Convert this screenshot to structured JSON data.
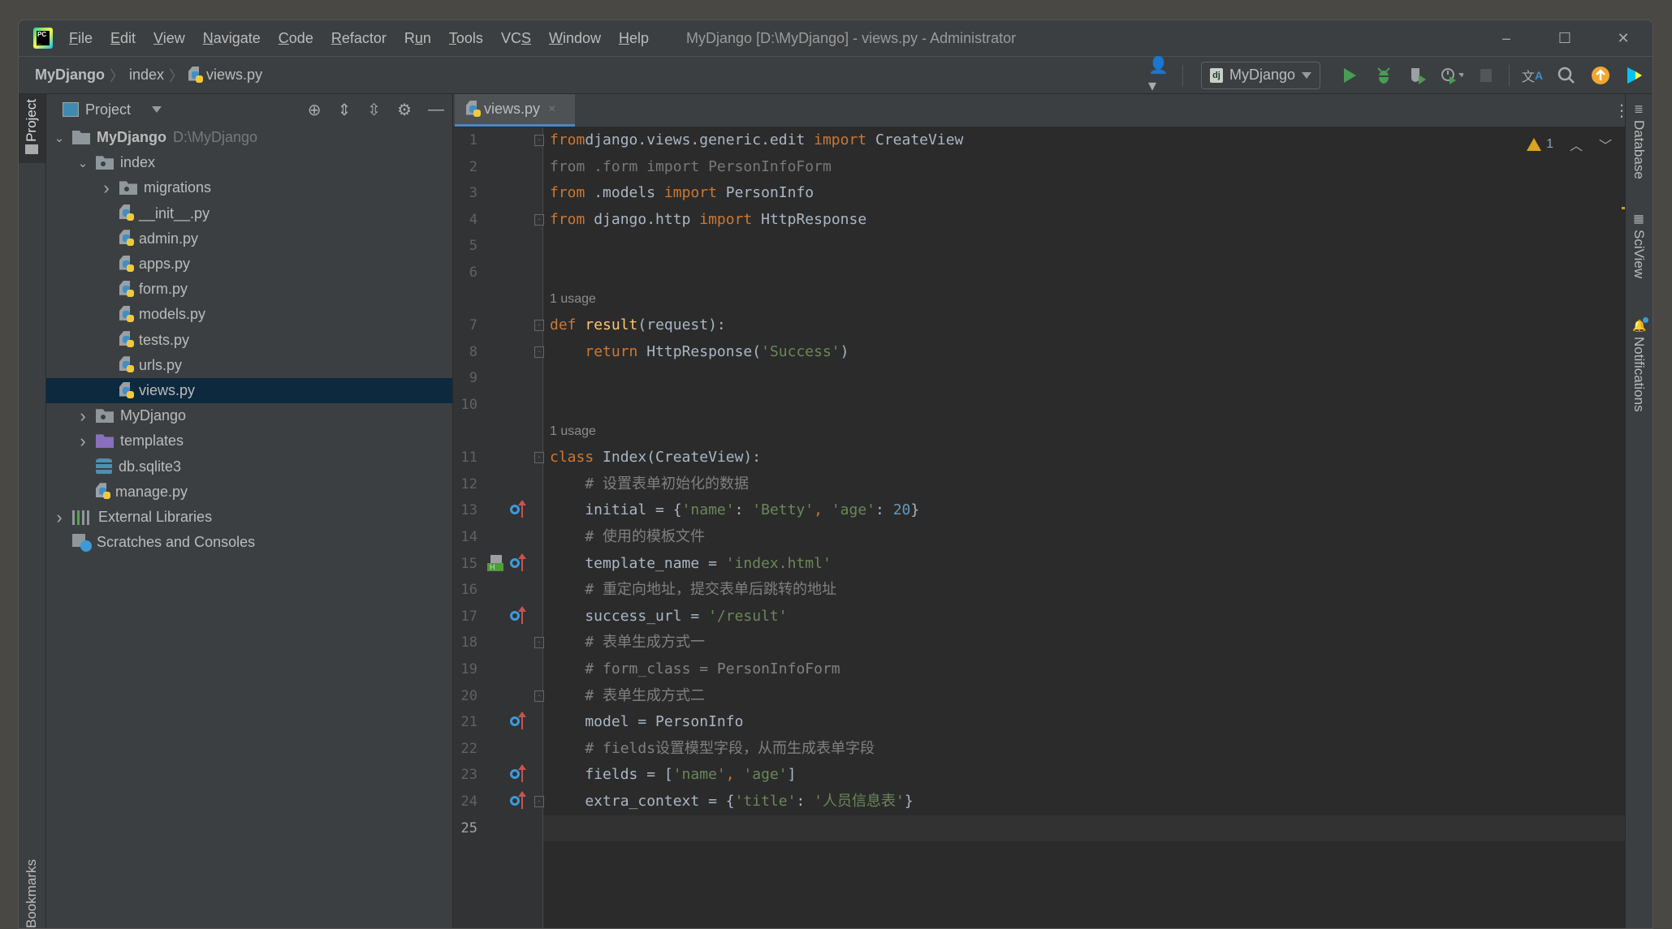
{
  "titlebar": {
    "menu": [
      {
        "label": "File",
        "mn": "F",
        "rest": "ile"
      },
      {
        "label": "Edit",
        "mn": "E",
        "rest": "dit"
      },
      {
        "label": "View",
        "mn": "V",
        "rest": "iew"
      },
      {
        "label": "Navigate",
        "mn": "N",
        "rest": "avigate"
      },
      {
        "label": "Code",
        "mn": "C",
        "rest": "ode"
      },
      {
        "label": "Refactor",
        "mn": "R",
        "rest": "efactor"
      },
      {
        "label": "Run",
        "pre": "R",
        "mn": "u",
        "rest": "n"
      },
      {
        "label": "Tools",
        "mn": "T",
        "rest": "ools"
      },
      {
        "label": "VCS",
        "pre": "VC",
        "mn": "S",
        "rest": ""
      },
      {
        "label": "Window",
        "mn": "W",
        "rest": "indow"
      },
      {
        "label": "Help",
        "mn": "H",
        "rest": "elp"
      }
    ],
    "window_title": "MyDjango [D:\\MyDjango] - views.py - Administrator",
    "controls": {
      "minimize": "–",
      "maximize": "☐",
      "close": "✕"
    }
  },
  "navbar": {
    "breadcrumb": [
      "MyDjango",
      "index",
      "views.py"
    ],
    "run_config": {
      "badge": "dj",
      "label": "MyDjango"
    },
    "icons": [
      "account-icon",
      "run-icon",
      "debug-icon",
      "coverage-icon",
      "profile-icon",
      "stop-icon",
      "translate-icon",
      "search-icon",
      "update-icon",
      "toolbox-icon"
    ],
    "colors": {
      "run": "#499c54",
      "update": "#f0a732"
    }
  },
  "left_strip": {
    "project_tab": "Project",
    "bookmarks_tab": "Bookmarks"
  },
  "project_panel": {
    "title": "Project",
    "tree": [
      {
        "depth": 0,
        "chevron": "open",
        "icon": "folder",
        "label": "MyDjango",
        "hint": "D:\\MyDjango",
        "bold": true
      },
      {
        "depth": 1,
        "chevron": "open",
        "icon": "module",
        "label": "index"
      },
      {
        "depth": 2,
        "chevron": "closed",
        "icon": "module",
        "label": "migrations"
      },
      {
        "depth": 2,
        "chevron": "none",
        "icon": "python",
        "label": "__init__.py"
      },
      {
        "depth": 2,
        "chevron": "none",
        "icon": "python",
        "label": "admin.py"
      },
      {
        "depth": 2,
        "chevron": "none",
        "icon": "python",
        "label": "apps.py"
      },
      {
        "depth": 2,
        "chevron": "none",
        "icon": "python",
        "label": "form.py"
      },
      {
        "depth": 2,
        "chevron": "none",
        "icon": "python",
        "label": "models.py"
      },
      {
        "depth": 2,
        "chevron": "none",
        "icon": "python",
        "label": "tests.py"
      },
      {
        "depth": 2,
        "chevron": "none",
        "icon": "python",
        "label": "urls.py"
      },
      {
        "depth": 2,
        "chevron": "none",
        "icon": "python",
        "label": "views.py",
        "selected": true
      },
      {
        "depth": 1,
        "chevron": "closed",
        "icon": "module",
        "label": "MyDjango"
      },
      {
        "depth": 1,
        "chevron": "closed",
        "icon": "templates",
        "label": "templates"
      },
      {
        "depth": 1,
        "chevron": "none",
        "icon": "database",
        "label": "db.sqlite3"
      },
      {
        "depth": 1,
        "chevron": "none",
        "icon": "python",
        "label": "manage.py"
      },
      {
        "depth": 0,
        "chevron": "closed",
        "icon": "library",
        "label": "External Libraries"
      },
      {
        "depth": 0,
        "chevron": "none",
        "icon": "scratch",
        "label": "Scratches and Consoles"
      }
    ]
  },
  "editor": {
    "tab": {
      "label": "views.py",
      "close": "×"
    },
    "inspection": {
      "warnings": "1"
    },
    "current_line": 25,
    "lines": [
      {
        "n": "1",
        "fold": "start",
        "tokens": [
          [
            "kw",
            "from"
          ],
          [
            "",
            "django.views.generic.edit "
          ],
          [
            "kw",
            "import"
          ],
          [
            "",
            " CreateView"
          ]
        ]
      },
      {
        "n": "2",
        "tokens": [
          [
            "unused",
            "from .form import PersonInfoForm"
          ]
        ]
      },
      {
        "n": "3",
        "tokens": [
          [
            "kw",
            "from"
          ],
          [
            "",
            " .models "
          ],
          [
            "kw",
            "import"
          ],
          [
            "",
            " PersonInfo"
          ]
        ]
      },
      {
        "n": "4",
        "fold": "end",
        "tokens": [
          [
            "kw",
            "from"
          ],
          [
            "",
            " django.http "
          ],
          [
            "kw",
            "import"
          ],
          [
            "",
            " HttpResponse"
          ]
        ]
      },
      {
        "n": "5",
        "tokens": []
      },
      {
        "n": "6",
        "tokens": []
      },
      {
        "hint": "1 usage"
      },
      {
        "n": "7",
        "fold": "start",
        "tokens": [
          [
            "kw",
            "def "
          ],
          [
            "fn",
            "result"
          ],
          [
            "",
            "(request):"
          ]
        ]
      },
      {
        "n": "8",
        "fold": "end",
        "tokens": [
          [
            "",
            "    "
          ],
          [
            "kw",
            "return"
          ],
          [
            "",
            " HttpResponse("
          ],
          [
            "str",
            "'Success'"
          ],
          [
            "",
            ")"
          ]
        ]
      },
      {
        "n": "9",
        "tokens": []
      },
      {
        "n": "10",
        "tokens": []
      },
      {
        "hint": "1 usage"
      },
      {
        "n": "11",
        "fold": "start",
        "tokens": [
          [
            "kw",
            "class"
          ],
          [
            "",
            " Index(CreateView):"
          ]
        ]
      },
      {
        "n": "12",
        "tokens": [
          [
            "",
            "    "
          ],
          [
            "cm",
            "# 设置表单初始化的数据"
          ]
        ]
      },
      {
        "n": "13",
        "override": true,
        "tokens": [
          [
            "",
            "    initial = {"
          ],
          [
            "str",
            "'name'"
          ],
          [
            "",
            ": "
          ],
          [
            "str",
            "'Betty'"
          ],
          [
            "kw",
            ","
          ],
          [
            " ",
            ""
          ],
          [
            "str",
            " 'age'"
          ],
          [
            "",
            ": "
          ],
          [
            "num",
            "20"
          ],
          [
            "",
            "}"
          ]
        ]
      },
      {
        "n": "14",
        "tokens": [
          [
            "",
            "    "
          ],
          [
            "cm",
            "# 使用的模板文件"
          ]
        ]
      },
      {
        "n": "15",
        "override": true,
        "html": true,
        "tokens": [
          [
            "",
            "    template_name = "
          ],
          [
            "str",
            "'index.html'"
          ]
        ]
      },
      {
        "n": "16",
        "tokens": [
          [
            "",
            "    "
          ],
          [
            "cm",
            "# 重定向地址，提交表单后跳转的地址"
          ]
        ]
      },
      {
        "n": "17",
        "override": true,
        "tokens": [
          [
            "",
            "    success_url = "
          ],
          [
            "str",
            "'/result'"
          ]
        ]
      },
      {
        "n": "18",
        "fold": "start",
        "tokens": [
          [
            "",
            "    "
          ],
          [
            "cm",
            "# 表单生成方式一"
          ]
        ]
      },
      {
        "n": "19",
        "tokens": [
          [
            "",
            "    "
          ],
          [
            "cm",
            "# form_class = PersonInfoForm"
          ]
        ]
      },
      {
        "n": "20",
        "fold": "end",
        "tokens": [
          [
            "",
            "    "
          ],
          [
            "cm",
            "# 表单生成方式二"
          ]
        ]
      },
      {
        "n": "21",
        "override": true,
        "tokens": [
          [
            "",
            "    model = PersonInfo"
          ]
        ]
      },
      {
        "n": "22",
        "tokens": [
          [
            "",
            "    "
          ],
          [
            "cm",
            "# fields设置模型字段，从而生成表单字段"
          ]
        ]
      },
      {
        "n": "23",
        "override": true,
        "tokens": [
          [
            "",
            "    fields = ["
          ],
          [
            "str",
            "'name'"
          ],
          [
            "kw",
            ","
          ],
          [
            "str",
            " 'age'"
          ],
          [
            "",
            "]"
          ]
        ]
      },
      {
        "n": "24",
        "override": true,
        "fold": "end",
        "tokens": [
          [
            "",
            "    extra_context = {"
          ],
          [
            "str",
            "'title'"
          ],
          [
            "",
            ": "
          ],
          [
            "str",
            "'人员信息表'"
          ],
          [
            "",
            "}"
          ]
        ]
      },
      {
        "n": "25",
        "tokens": []
      }
    ]
  },
  "right_strip": {
    "items": [
      "Database",
      "SciView",
      "Notifications"
    ]
  }
}
